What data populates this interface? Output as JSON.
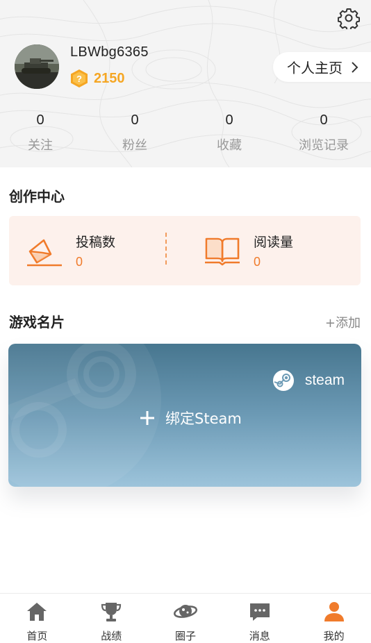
{
  "header": {
    "settings_icon": "gear-icon",
    "username": "LBWbg6365",
    "coins": "2150",
    "homepage_label": "个人主页"
  },
  "stats": [
    {
      "value": "0",
      "label": "关注"
    },
    {
      "value": "0",
      "label": "粉丝"
    },
    {
      "value": "0",
      "label": "收藏"
    },
    {
      "value": "0",
      "label": "浏览记录"
    }
  ],
  "creator": {
    "title": "创作中心",
    "items": [
      {
        "label": "投稿数",
        "value": "0",
        "icon": "envelope-icon"
      },
      {
        "label": "阅读量",
        "value": "0",
        "icon": "book-icon"
      }
    ]
  },
  "game_cards": {
    "title": "游戏名片",
    "add_label": "+添加",
    "steam_brand": "steam",
    "bind_label": "绑定Steam"
  },
  "bottom_nav": [
    {
      "label": "首页",
      "icon": "home-icon"
    },
    {
      "label": "战绩",
      "icon": "trophy-icon"
    },
    {
      "label": "圈子",
      "icon": "planet-icon"
    },
    {
      "label": "消息",
      "icon": "message-icon"
    },
    {
      "label": "我的",
      "icon": "person-icon",
      "active": true
    }
  ],
  "colors": {
    "accent": "#f07b2b",
    "coin": "#f5a623",
    "creator_bg": "#fdf1ec",
    "steam_top": "#47768f",
    "steam_bottom": "#9dc4db"
  }
}
